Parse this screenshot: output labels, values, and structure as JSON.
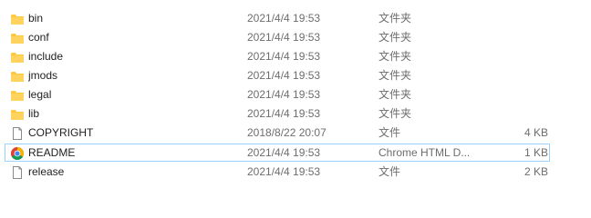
{
  "files": [
    {
      "name": "bin",
      "modified": "2021/4/4 19:53",
      "type": "文件夹",
      "size": "",
      "icon": "folder-icon"
    },
    {
      "name": "conf",
      "modified": "2021/4/4 19:53",
      "type": "文件夹",
      "size": "",
      "icon": "folder-icon"
    },
    {
      "name": "include",
      "modified": "2021/4/4 19:53",
      "type": "文件夹",
      "size": "",
      "icon": "folder-icon"
    },
    {
      "name": "jmods",
      "modified": "2021/4/4 19:53",
      "type": "文件夹",
      "size": "",
      "icon": "folder-icon"
    },
    {
      "name": "legal",
      "modified": "2021/4/4 19:53",
      "type": "文件夹",
      "size": "",
      "icon": "folder-icon"
    },
    {
      "name": "lib",
      "modified": "2021/4/4 19:53",
      "type": "文件夹",
      "size": "",
      "icon": "folder-icon"
    },
    {
      "name": "COPYRIGHT",
      "modified": "2018/8/22 20:07",
      "type": "文件",
      "size": "4 KB",
      "icon": "file-icon"
    },
    {
      "name": "README",
      "modified": "2021/4/4 19:53",
      "type": "Chrome HTML D...",
      "size": "1 KB",
      "icon": "chrome-icon"
    },
    {
      "name": "release",
      "modified": "2021/4/4 19:53",
      "type": "文件",
      "size": "2 KB",
      "icon": "file-icon"
    }
  ],
  "colors": {
    "folder": "#ffc83d",
    "selection_border": "#99d1ff",
    "secondary_text": "#6d6d6d"
  }
}
